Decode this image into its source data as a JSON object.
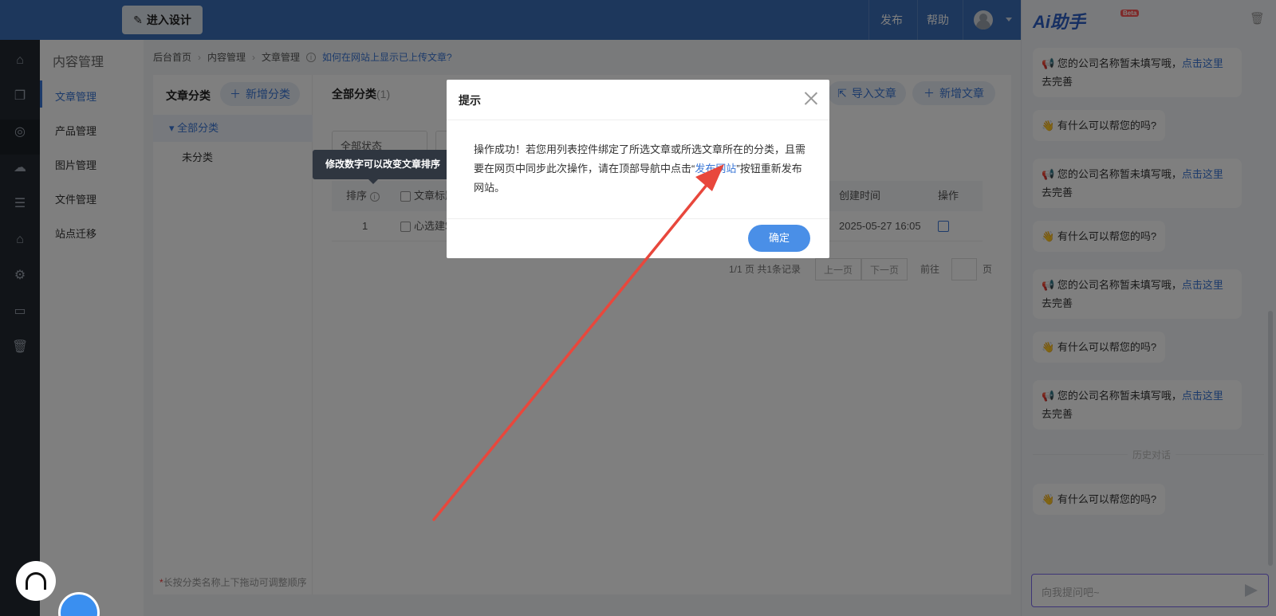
{
  "topbar": {
    "design_label": "进入设计",
    "publish": "发布",
    "help": "帮助"
  },
  "subnav": {
    "title": "内容管理",
    "items": [
      "文章管理",
      "产品管理",
      "图片管理",
      "文件管理",
      "站点迁移"
    ]
  },
  "breadcrumb": {
    "home": "后台首页",
    "content": "内容管理",
    "article": "文章管理",
    "help_link": "如何在网站上显示已上传文章?"
  },
  "categories": {
    "heading": "文章分类",
    "add_label": "新增分类",
    "all": "全部分类",
    "uncategorized": "未分类",
    "footer_star": "*",
    "footer": "长按分类名称上下拖动可调整顺序"
  },
  "list": {
    "heading": "全部分类",
    "count": "(1)",
    "import_label": "导入文章",
    "add_label": "新增文章",
    "status_select": "全部状态",
    "columns": {
      "order": "排序",
      "title": "文章标题",
      "created": "创建时间",
      "action": "操作"
    },
    "rows": [
      {
        "order": "1",
        "title": "心选建筑",
        "created": "2025-05-27 16:05"
      }
    ],
    "pager": {
      "info": "1/1 页 共1条记录",
      "prev": "上一页",
      "next": "下一页",
      "goto": "前往",
      "page_unit": "页"
    }
  },
  "tooltip": {
    "text": "修改数字可以改变文章排序",
    "close": "×"
  },
  "dialog": {
    "title": "提示",
    "body_before": "操作成功！若您用列表控件绑定了所选文章或所选文章所在的分类，且需要在网页中同步此次操作，请在顶部导航中点击“",
    "body_link": "发布网站",
    "body_after": "”按钮重新发布网站。",
    "ok": "确定"
  },
  "ai": {
    "logo": "Ai助手",
    "beta": "Beta",
    "messages": [
      {
        "type": "notice",
        "text": "您的公司名称暂未填写哦，",
        "link": "点击这里",
        "tail": "去完善"
      },
      {
        "type": "ask",
        "text": "有什么可以帮您的吗?"
      },
      {
        "type": "notice",
        "text": "您的公司名称暂未填写哦，",
        "link": "点击这里",
        "tail": "去完善"
      },
      {
        "type": "ask",
        "text": "有什么可以帮您的吗?"
      },
      {
        "type": "notice",
        "text": "您的公司名称暂未填写哦，",
        "link": "点击这里",
        "tail": "去完善"
      },
      {
        "type": "ask",
        "text": "有什么可以帮您的吗?"
      },
      {
        "type": "notice",
        "text": "您的公司名称暂未填写哦，",
        "link": "点击这里",
        "tail": "去完善"
      }
    ],
    "history_label": "历史对话",
    "last_message": "有什么可以帮您的吗?",
    "input_placeholder": "向我提问吧~"
  },
  "colors": {
    "brand": "#3b6fb8",
    "accent": "#4a8fe7",
    "arrow": "#e8473c"
  }
}
